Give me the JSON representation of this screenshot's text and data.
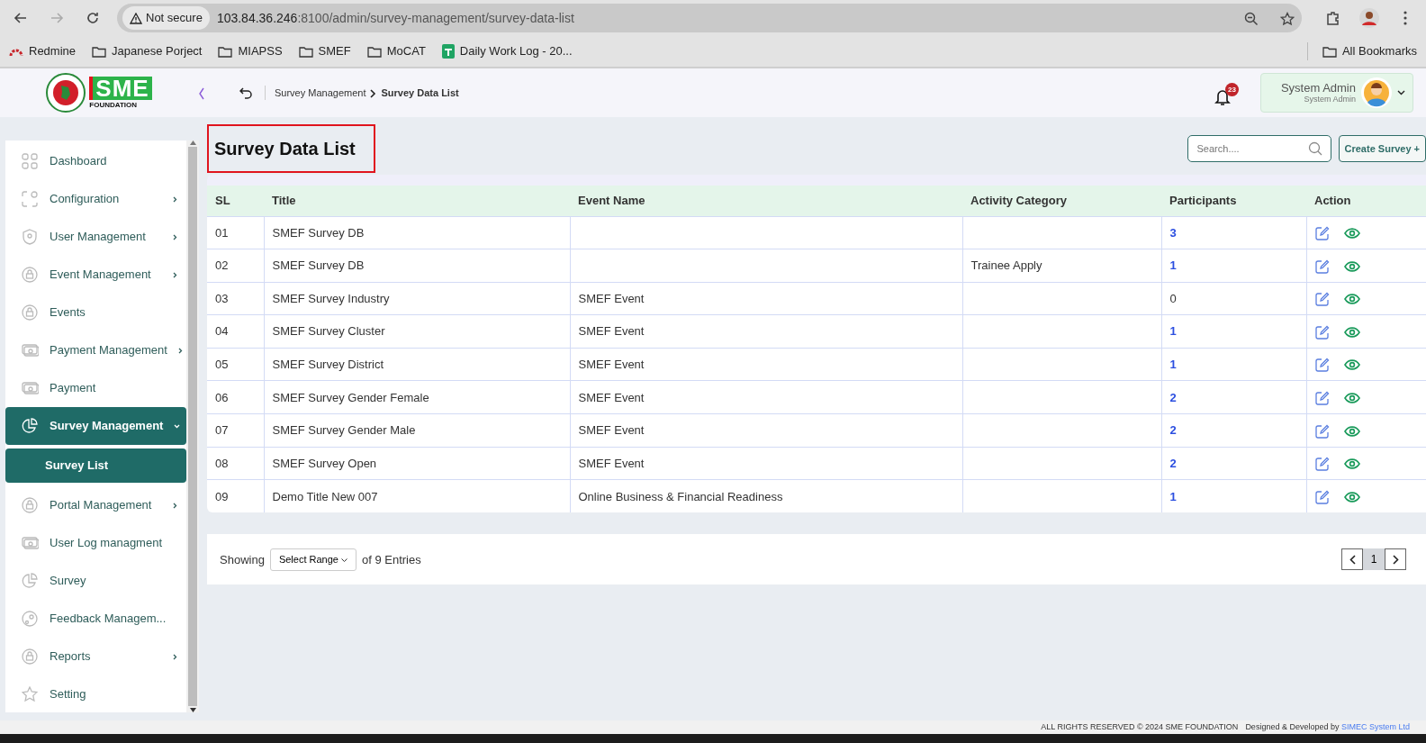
{
  "browser": {
    "security": "Not secure",
    "url_host": "103.84.36.246",
    "url_path": ":8100/admin/survey-management/survey-data-list",
    "bookmarks": [
      {
        "label": "Redmine",
        "kind": "redmine"
      },
      {
        "label": "Japanese Porject",
        "kind": "folder"
      },
      {
        "label": "MIAPSS",
        "kind": "folder"
      },
      {
        "label": "SMEF",
        "kind": "folder"
      },
      {
        "label": "MoCAT",
        "kind": "folder"
      },
      {
        "label": "Daily Work Log - 20...",
        "kind": "sheet"
      }
    ],
    "all_bookmarks": "All Bookmarks"
  },
  "header": {
    "logo_text": "SME",
    "logo_sub": "FOUNDATION",
    "breadcrumb": [
      "Survey Management",
      "Survey Data List"
    ],
    "notifications": "23",
    "user_name": "System Admin",
    "user_role": "System Admin"
  },
  "sidebar": {
    "items": [
      {
        "label": "Dashboard",
        "kind": "link",
        "selected": false
      },
      {
        "label": "Configuration",
        "kind": "menu",
        "selected": false,
        "expanded": false
      },
      {
        "label": "User Management",
        "kind": "menu",
        "selected": false,
        "expanded": false
      },
      {
        "label": "Event Management",
        "kind": "menu",
        "selected": false,
        "expanded": false
      },
      {
        "label": "Events",
        "kind": "link",
        "selected": false
      },
      {
        "label": "Payment Management",
        "kind": "menu",
        "selected": false,
        "expanded": false
      },
      {
        "label": "Payment",
        "kind": "link",
        "selected": false
      },
      {
        "label": "Survey Management",
        "kind": "menu",
        "selected": true,
        "expanded": true,
        "children": [
          {
            "label": "Survey List",
            "selected": true
          }
        ]
      },
      {
        "label": "Portal Management",
        "kind": "menu",
        "selected": false,
        "expanded": false
      },
      {
        "label": "User Log managment",
        "kind": "link",
        "selected": false
      },
      {
        "label": "Survey",
        "kind": "link",
        "selected": false
      },
      {
        "label": "Feedback Managem...",
        "kind": "link",
        "selected": false
      },
      {
        "label": "Reports",
        "kind": "menu",
        "selected": false,
        "expanded": false
      },
      {
        "label": "Setting",
        "kind": "link",
        "selected": false
      }
    ]
  },
  "page": {
    "title": "Survey Data List",
    "search": {
      "placeholder": "Search...."
    },
    "create_button": "Create Survey +"
  },
  "table": {
    "columns": [
      "SL",
      "Title",
      "Event Name",
      "Activity Category",
      "Participants",
      "Action"
    ],
    "rows": [
      {
        "sl": "01",
        "title": "SMEF Survey DB",
        "event": "",
        "category": "",
        "participants": "3",
        "linked": true
      },
      {
        "sl": "02",
        "title": "SMEF Survey DB",
        "event": "",
        "category": "Trainee Apply",
        "participants": "1",
        "linked": true
      },
      {
        "sl": "03",
        "title": "SMEF Survey Industry",
        "event": "SMEF Event",
        "category": "",
        "participants": "0",
        "linked": false
      },
      {
        "sl": "04",
        "title": "SMEF Survey Cluster",
        "event": "SMEF Event",
        "category": "",
        "participants": "1",
        "linked": true
      },
      {
        "sl": "05",
        "title": "SMEF Survey District",
        "event": "SMEF Event",
        "category": "",
        "participants": "1",
        "linked": true
      },
      {
        "sl": "06",
        "title": "SMEF Survey Gender Female",
        "event": "SMEF Event",
        "category": "",
        "participants": "2",
        "linked": true
      },
      {
        "sl": "07",
        "title": "SMEF Survey Gender Male",
        "event": "SMEF Event",
        "category": "",
        "participants": "2",
        "linked": true
      },
      {
        "sl": "08",
        "title": "SMEF Survey Open",
        "event": "SMEF Event",
        "category": "",
        "participants": "2",
        "linked": true
      },
      {
        "sl": "09",
        "title": "Demo Title New 007",
        "event": "Online Business & Financial Readiness",
        "category": "",
        "participants": "1",
        "linked": true
      }
    ]
  },
  "pagination": {
    "showing": "Showing",
    "range": "Select Range",
    "entries": "of 9 Entries",
    "pages": [
      {
        "label": "1",
        "selected": true
      }
    ]
  },
  "footer": {
    "rights": "ALL RIGHTS RESERVED © 2024 SME FOUNDATION",
    "designed": "Designed & Developed by",
    "company": "SIMEC System Ltd"
  }
}
